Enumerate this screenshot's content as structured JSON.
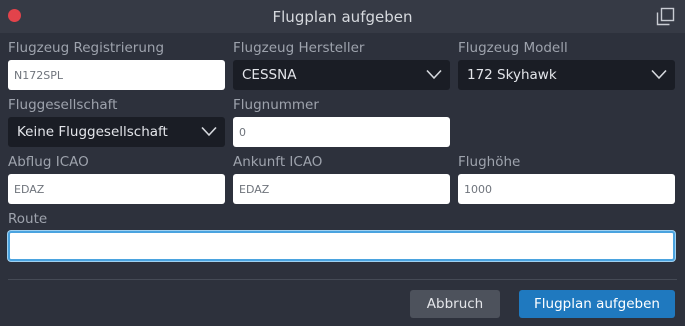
{
  "window": {
    "title": "Flugplan aufgeben"
  },
  "fields": {
    "registration": {
      "label": "Flugzeug Registrierung",
      "value": "N172SPL"
    },
    "manufacturer": {
      "label": "Flugzeug Hersteller",
      "value": "CESSNA"
    },
    "model": {
      "label": "Flugzeug Modell",
      "value": "172 Skyhawk"
    },
    "airline": {
      "label": "Fluggesellschaft",
      "value": "Keine Fluggesellschaft"
    },
    "flight_number": {
      "label": "Flugnummer",
      "value": "0"
    },
    "departure": {
      "label": "Abflug ICAO",
      "value": "EDAZ"
    },
    "arrival": {
      "label": "Ankunft ICAO",
      "value": "EDAZ"
    },
    "altitude": {
      "label": "Flughöhe",
      "value": "1000"
    },
    "route": {
      "label": "Route",
      "value": ""
    }
  },
  "buttons": {
    "cancel": "Abbruch",
    "submit": "Flugplan aufgeben"
  },
  "colors": {
    "background": "#2d313c",
    "titlebar": "#363a45",
    "close": "#e2434b",
    "select_bg": "#1a1d25",
    "primary": "#1f79bf",
    "focus": "#4aa3df"
  },
  "icons": {
    "close": "close-icon",
    "popout": "popout-icon",
    "chevron": "chevron-down-icon"
  }
}
